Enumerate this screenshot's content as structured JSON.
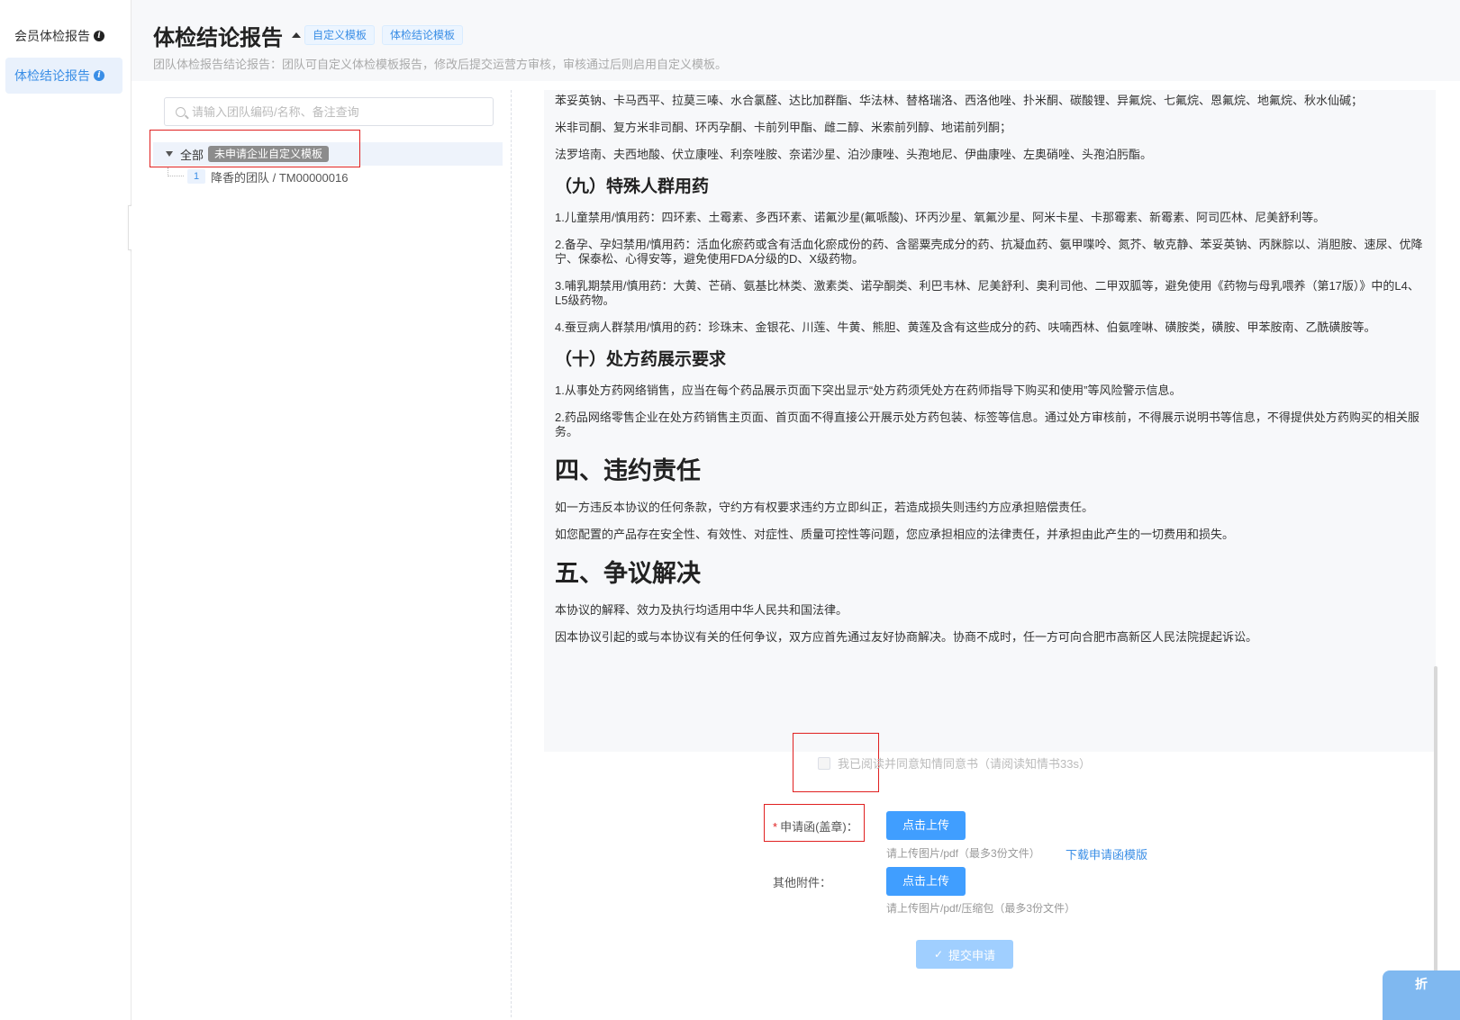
{
  "sidebar": {
    "items": [
      {
        "label": "会员体检报告",
        "active": false
      },
      {
        "label": "体检结论报告",
        "active": true
      }
    ]
  },
  "header": {
    "title": "体检结论报告",
    "tabs": [
      "自定义模板",
      "体检结论模板"
    ],
    "subtitle": "团队体检报告结论报告：团队可自定义体检模板报告，修改后提交运营方审核，审核通过后则启用自定义模板。"
  },
  "tree": {
    "search_placeholder": "请输入团队编码/名称、备注查询",
    "root_label": "全部",
    "root_tag": "未申请企业自定义模板",
    "children": [
      {
        "index": "1",
        "label": "降香的团队 / TM00000016"
      }
    ]
  },
  "doc": {
    "blocks": [
      {
        "type": "p",
        "text": "苯妥英钠、卡马西平、拉莫三嗪、水合氯醛、达比加群酯、华法林、替格瑞洛、西洛他唑、扑米酮、碳酸锂、异氟烷、七氟烷、恩氟烷、地氟烷、秋水仙碱；"
      },
      {
        "type": "p",
        "text": "米非司酮、复方米非司酮、环丙孕酮、卡前列甲酯、雌二醇、米索前列醇、地诺前列酮；"
      },
      {
        "type": "p",
        "text": "法罗培南、夫西地酸、伏立康唑、利奈唑胺、奈诺沙星、泊沙康唑、头孢地尼、伊曲康唑、左奥硝唑、头孢泊肟酯。"
      },
      {
        "type": "h3",
        "text": "（九）特殊人群用药"
      },
      {
        "type": "p",
        "text": "1.儿童禁用/慎用药：四环素、土霉素、多西环素、诺氟沙星(氟哌酸)、环丙沙星、氧氟沙星、阿米卡星、卡那霉素、新霉素、阿司匹林、尼美舒利等。"
      },
      {
        "type": "p",
        "text": "2.备孕、孕妇禁用/慎用药：活血化瘀药或含有活血化瘀成份的药、含罂粟壳成分的药、抗凝血药、氨甲喋呤、氮芥、敏克静、苯妥英钠、丙脒腙以、消胆胺、速尿、优降宁、保泰松、心得安等，避免使用FDA分级的D、X级药物。"
      },
      {
        "type": "p",
        "text": "3.哺乳期禁用/慎用药：大黄、芒硝、氨基比林类、激素类、诺孕酮类、利巴韦林、尼美舒利、奥利司他、二甲双胍等，避免使用《药物与母乳喂养（第17版）》中的L4、L5级药物。"
      },
      {
        "type": "p",
        "text": "4.蚕豆病人群禁用/慎用的药：珍珠末、金银花、川莲、牛黄、熊胆、黄莲及含有这些成分的药、呋喃西林、伯氨喹啉、磺胺类，磺胺、甲苯胺南、乙酰磺胺等。"
      },
      {
        "type": "h3",
        "text": "（十）处方药展示要求"
      },
      {
        "type": "p",
        "text": "1.从事处方药网络销售，应当在每个药品展示页面下突出显示“处方药须凭处方在药师指导下购买和使用”等风险警示信息。"
      },
      {
        "type": "p",
        "text": "2.药品网络零售企业在处方药销售主页面、首页面不得直接公开展示处方药包装、标签等信息。通过处方审核前，不得展示说明书等信息，不得提供处方药购买的相关服务。"
      },
      {
        "type": "h2",
        "text": "四、违约责任"
      },
      {
        "type": "p",
        "text": "如一方违反本协议的任何条款，守约方有权要求违约方立即纠正，若造成损失则违约方应承担赔偿责任。"
      },
      {
        "type": "p",
        "text": "如您配置的产品存在安全性、有效性、对症性、质量可控性等问题，您应承担相应的法律责任，并承担由此产生的一切费用和损失。"
      },
      {
        "type": "h2",
        "text": "五、争议解决"
      },
      {
        "type": "p",
        "text": "本协议的解释、效力及执行均适用中华人民共和国法律。"
      },
      {
        "type": "p",
        "text": "因本协议引起的或与本协议有关的任何争议，双方应首先通过友好协商解决。协商不成时，任一方可向合肥市高新区人民法院提起诉讼。"
      }
    ]
  },
  "form": {
    "consent_label": "我已阅读并同意知情同意书（请阅读知情书33s）",
    "consent_checked": false,
    "application_label": "申请函(盖章)：",
    "upload_label": "点击上传",
    "application_hint": "请上传图片/pdf（最多3份文件）",
    "download_link": "下载申请函模版",
    "other_label": "其他附件：",
    "other_hint": "请上传图片/pdf/压缩包（最多3份文件）",
    "submit_label": "提交申请"
  },
  "corner_chip": "折",
  "colors": {
    "primary": "#409eff",
    "disabled": "#a0cfff",
    "highlight_box": "#e02020"
  }
}
